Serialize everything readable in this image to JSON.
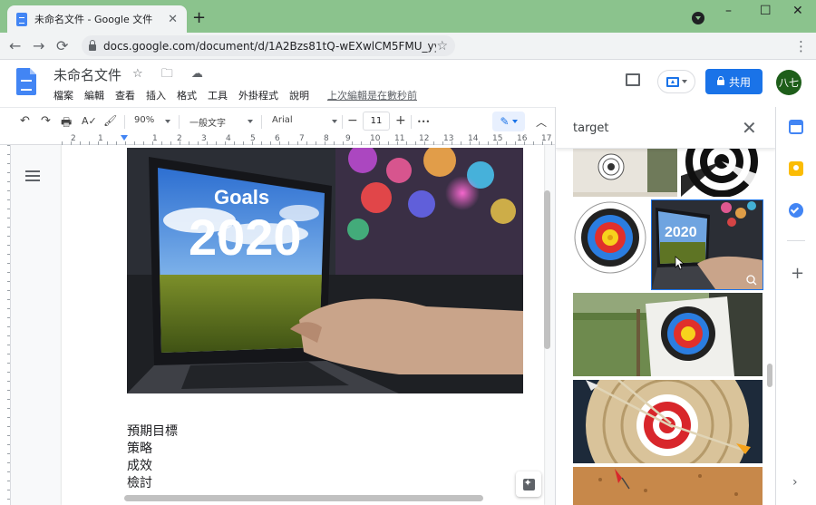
{
  "browser": {
    "tab_title": "未命名文件 - Google 文件",
    "tab_close": "✕",
    "new_tab": "+",
    "window_controls": [
      "–",
      "☐",
      "✕"
    ],
    "url": "docs.google.com/document/d/1A2Bzs81tQ-wEXwlCM5FMU_yy...",
    "nav": {
      "back": "←",
      "forward": "→",
      "reload": "⟳"
    },
    "bookmark_icon": "☆",
    "menu_icon": "⋮"
  },
  "docs": {
    "title": "未命名文件",
    "title_icons": "☆ 🗀 ☁",
    "menu": [
      "檔案",
      "編輯",
      "查看",
      "插入",
      "格式",
      "工具",
      "外掛程式",
      "說明"
    ],
    "last_edit": "上次編輯是在數秒前",
    "share_label": "共用",
    "avatar_label": "八七"
  },
  "toolbar": {
    "undo": "↶",
    "redo": "↷",
    "print": "🖶",
    "spell": "A✓",
    "paint": "🖌",
    "zoom": "90%",
    "style": "一般文字",
    "font": "Arial",
    "minus": "−",
    "size": "11",
    "plus": "+",
    "more": "•••",
    "edit_icon": "✎",
    "collapse": "︿"
  },
  "ruler": {
    "labels": [
      "2",
      "1",
      "1",
      "2",
      "3",
      "4",
      "5",
      "6",
      "7",
      "8",
      "9",
      "10",
      "11",
      "12",
      "13",
      "14",
      "15",
      "16",
      "17"
    ]
  },
  "document": {
    "photo_text_top": "Goals",
    "photo_text_big": "2020",
    "lines": [
      "預期目標",
      "策略",
      "成效",
      "檢討"
    ]
  },
  "explore": {
    "query": "target",
    "close_icon": "✕",
    "zoom_icon": "⌕"
  },
  "colors": {
    "accent": "#1a73e8",
    "chrome_frame": "#8bc38d",
    "avatar": "#1e5e1a"
  }
}
